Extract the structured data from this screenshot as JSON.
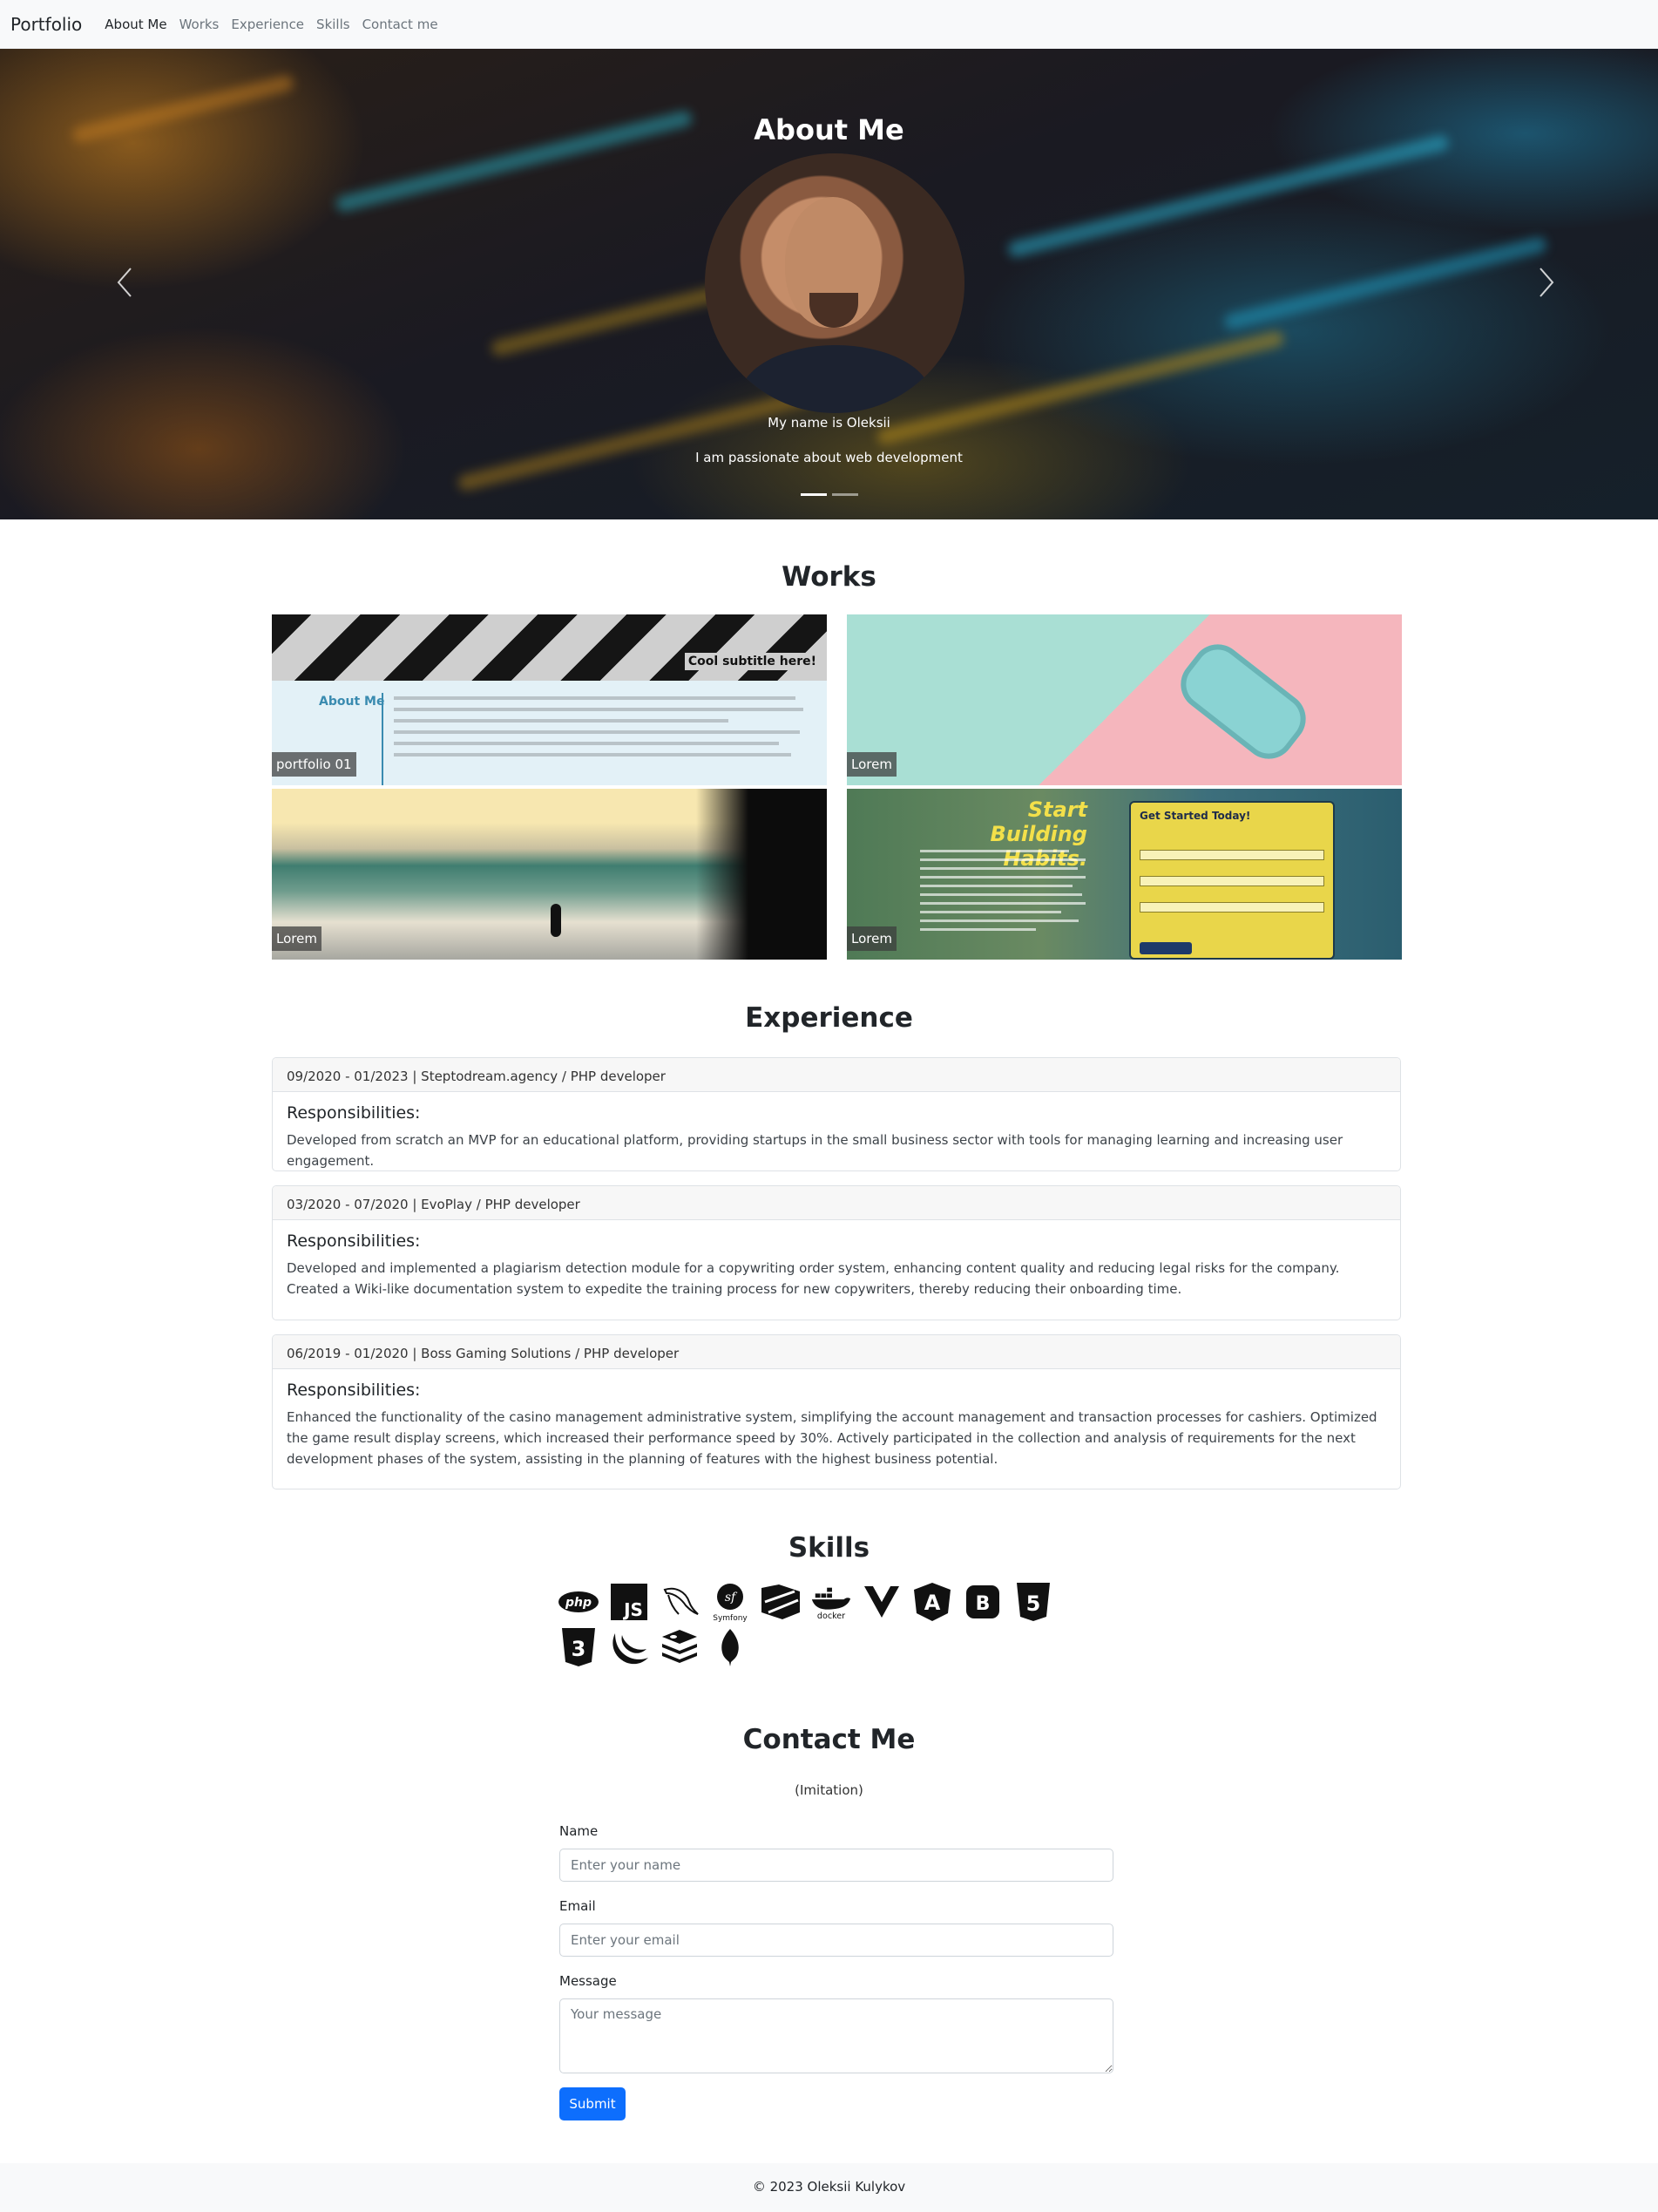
{
  "nav": {
    "brand": "Portfolio",
    "links": [
      "About Me",
      "Works",
      "Experience",
      "Skills",
      "Contact me"
    ]
  },
  "hero": {
    "title": "About Me",
    "line1": "My name is Oleksii",
    "line2": "I am passionate about web development",
    "prev_icon": "chevron-left-icon",
    "next_icon": "chevron-right-icon",
    "slides": 2,
    "active_slide": 1
  },
  "works": {
    "title": "Works",
    "items": [
      {
        "label": "portfolio 01",
        "subtitle": "Cool subtitle here!",
        "heading": "About Me"
      },
      {
        "label": "Lorem"
      },
      {
        "label": "Lorem"
      },
      {
        "label": "Lorem",
        "heading": "Start Building Habits.",
        "form_title": "Get Started Today!"
      }
    ]
  },
  "experience": {
    "title": "Experience",
    "items": [
      {
        "header": "09/2020 - 01/2023 | Steptodream.agency / PHP developer",
        "title": "Responsibilities:",
        "text": "Developed from scratch an MVP for an educational platform, providing startups in the small business sector with tools for managing learning and increasing user engagement."
      },
      {
        "header": "03/2020 - 07/2020 | EvoPlay / PHP developer",
        "title": "Responsibilities:",
        "text": "Developed and implemented a plagiarism detection module for a copywriting order system, enhancing content quality and reducing legal risks for the company. Created a Wiki-like documentation system to expedite the training process for new copywriters, thereby reducing their onboarding time."
      },
      {
        "header": "06/2019 - 01/2020 | Boss Gaming Solutions / PHP developer",
        "title": "Responsibilities:",
        "text": "Enhanced the functionality of the casino management administrative system, simplifying the account management and transaction processes for cashiers. Optimized the game result display screens, which increased their performance speed by 30%. Actively participated in the collection and analysis of requirements for the next development phases of the system, assisting in the planning of features with the highest business potential."
      }
    ]
  },
  "skills": {
    "title": "Skills",
    "icons": [
      "php-icon",
      "javascript-icon",
      "mysql-icon",
      "symfony-icon",
      "laravel-icon",
      "docker-icon",
      "vue-icon",
      "angular-icon",
      "bootstrap-icon",
      "html5-icon",
      "css3-icon",
      "jquery-icon",
      "redis-icon",
      "mongodb-icon"
    ],
    "icon_texts": {
      "php": "php",
      "js": "JS",
      "symfony": "Symfony",
      "docker": "docker",
      "b": "B",
      "a": "A",
      "five": "5",
      "three": "3"
    }
  },
  "contact": {
    "title": "Contact Me",
    "subtitle": "(Imitation)",
    "name_label": "Name",
    "name_placeholder": "Enter your name",
    "email_label": "Email",
    "email_placeholder": "Enter your email",
    "message_label": "Message",
    "message_placeholder": "Your message",
    "submit_label": "Submit",
    "accent": "#0d6efd"
  },
  "footer": {
    "text": "© 2023 Oleksii Kulykov"
  }
}
